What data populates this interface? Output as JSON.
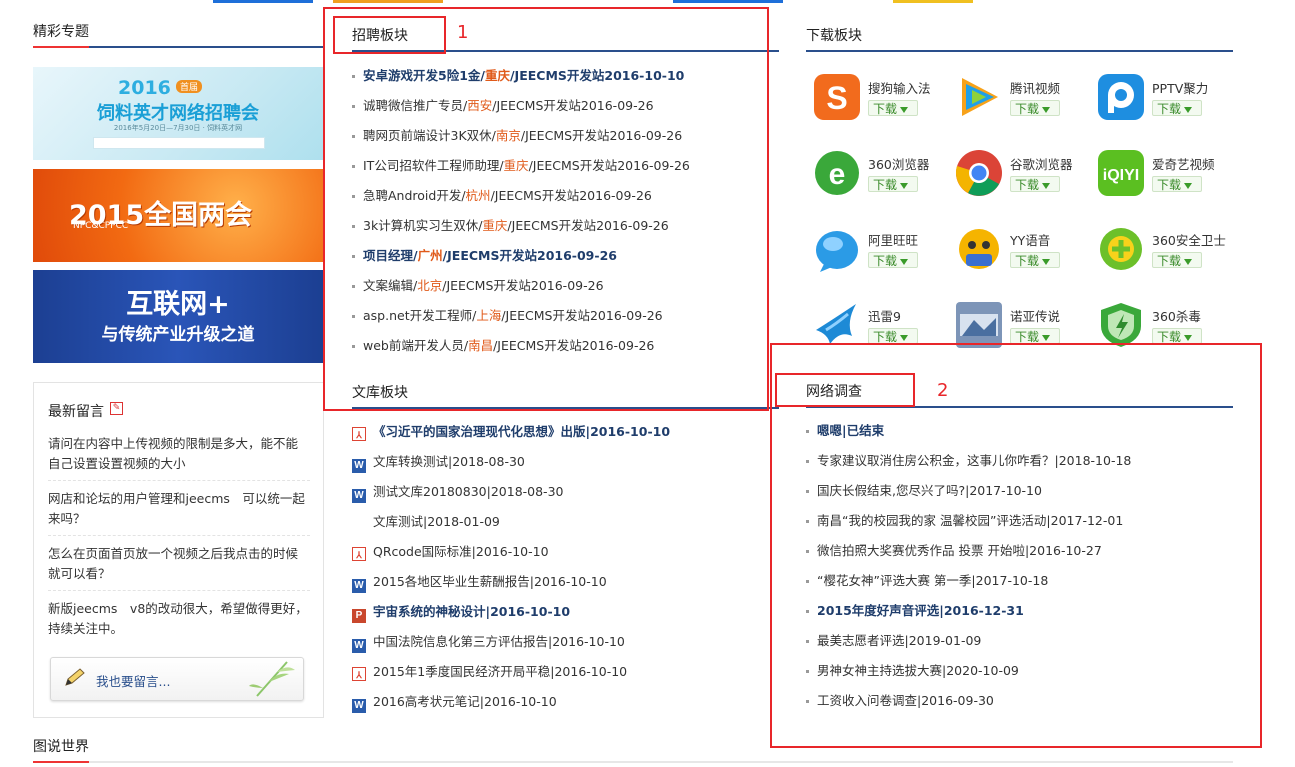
{
  "annotations": {
    "box1_number": "1",
    "box2_number": "2"
  },
  "featured": {
    "title": "精彩专题",
    "banners": [
      {
        "title": "饲料英才网络招聘会",
        "year": "2016",
        "tag": "首届",
        "sub": "2016年5月20日—7月30日 · 饲料英才网"
      },
      {
        "title": "2015全国两会",
        "sub": "NPC&CPPCC"
      },
      {
        "title": "互联网+",
        "sub": "与传统产业升级之道"
      }
    ]
  },
  "messages": {
    "title": "最新留言",
    "items": [
      "请问在内容中上传视频的限制是多大，能不能自己设置设置视频的大小",
      "网店和论坛的用户管理和jeecms　可以统一起来吗？",
      "怎么在页面首页放一个视频之后我点击的时候就可以看？",
      "新版jeecms　v8的改动很大，希望做得更好，持续关注中。"
    ],
    "leave_button": "我也要留言..."
  },
  "recruit": {
    "title": "招聘板块",
    "items": [
      {
        "job": "安卓游戏开发5险1金/",
        "city": "重庆",
        "rest": "/JEECMS开发站2016-10-10",
        "bold": true
      },
      {
        "job": "诚聘微信推广专员/",
        "city": "西安",
        "rest": "/JEECMS开发站2016-09-26",
        "bold": false
      },
      {
        "job": "聘网页前端设计3K双休/",
        "city": "南京",
        "rest": "/JEECMS开发站2016-09-26",
        "bold": false
      },
      {
        "job": "IT公司招软件工程师助理/",
        "city": "重庆",
        "rest": "/JEECMS开发站2016-09-26",
        "bold": false
      },
      {
        "job": "急聘Android开发/",
        "city": "杭州",
        "rest": "/JEECMS开发站2016-09-26",
        "bold": false
      },
      {
        "job": "3k计算机实习生双休/",
        "city": "重庆",
        "rest": "/JEECMS开发站2016-09-26",
        "bold": false
      },
      {
        "job": "项目经理/",
        "city": "广州",
        "rest": "/JEECMS开发站2016-09-26",
        "bold": true
      },
      {
        "job": "文案编辑/",
        "city": "北京",
        "rest": "/JEECMS开发站2016-09-26",
        "bold": false
      },
      {
        "job": "asp.net开发工程师/",
        "city": "上海",
        "rest": "/JEECMS开发站2016-09-26",
        "bold": false
      },
      {
        "job": "web前端开发人员/",
        "city": "南昌",
        "rest": "/JEECMS开发站2016-09-26",
        "bold": false
      }
    ]
  },
  "library": {
    "title": "文库板块",
    "items": [
      {
        "icon": "pdf",
        "text": "《习近平的国家治理现代化思想》出版|2016-10-10",
        "bold": true
      },
      {
        "icon": "word",
        "text": "文库转换测试|2018-08-30",
        "bold": false
      },
      {
        "icon": "word",
        "text": "测试文库20180830|2018-08-30",
        "bold": false
      },
      {
        "icon": "none",
        "text": "文库测试|2018-01-09",
        "bold": false
      },
      {
        "icon": "pdf",
        "text": "QRcode国际标准|2016-10-10",
        "bold": false
      },
      {
        "icon": "word",
        "text": "2015各地区毕业生薪酬报告|2016-10-10",
        "bold": false
      },
      {
        "icon": "ppt",
        "text": "宇宙系统的神秘设计|2016-10-10",
        "bold": true
      },
      {
        "icon": "word",
        "text": "中国法院信息化第三方评估报告|2016-10-10",
        "bold": false
      },
      {
        "icon": "pdf",
        "text": "2015年1季度国民经济开局平稳|2016-10-10",
        "bold": false
      },
      {
        "icon": "word",
        "text": "2016高考状元笔记|2016-10-10",
        "bold": false
      }
    ]
  },
  "downloads": {
    "title": "下载板块",
    "button_label": "下载",
    "apps": [
      {
        "name": "搜狗输入法",
        "icon": "sogou-icon",
        "color": "#f26b1d"
      },
      {
        "name": "腾讯视频",
        "icon": "tencent-video-icon",
        "color": "#20a0e8"
      },
      {
        "name": "PPTV聚力",
        "icon": "pptv-icon",
        "color": "#1e8ee0"
      },
      {
        "name": "360浏览器",
        "icon": "360-browser-icon",
        "color": "#3aa83a"
      },
      {
        "name": "谷歌浏览器",
        "icon": "chrome-icon",
        "color": "#db4437"
      },
      {
        "name": "爱奇艺视频",
        "icon": "iqiyi-icon",
        "color": "#5bbf21"
      },
      {
        "name": "阿里旺旺",
        "icon": "aliwangwang-icon",
        "color": "#2b9be6"
      },
      {
        "name": "YY语音",
        "icon": "yy-icon",
        "color": "#f5b400"
      },
      {
        "name": "360安全卫士",
        "icon": "360-safe-icon",
        "color": "#6cc02a"
      },
      {
        "name": "迅雷9",
        "icon": "xunlei-icon",
        "color": "#1d8ad6"
      },
      {
        "name": "诺亚传说",
        "icon": "noah-icon",
        "color": "#4a6fa0"
      },
      {
        "name": "360杀毒",
        "icon": "360-antivirus-icon",
        "color": "#3aa83a"
      }
    ]
  },
  "survey": {
    "title": "网络调查",
    "items": [
      {
        "text": "嗯嗯|已结束",
        "bold": true
      },
      {
        "text": "专家建议取消住房公积金，这事儿你咋看？|2018-10-18",
        "bold": false
      },
      {
        "text": "国庆长假结束,您尽兴了吗?|2017-10-10",
        "bold": false
      },
      {
        "text": "南昌“我的校园我的家 温馨校园”评选活动|2017-12-01",
        "bold": false
      },
      {
        "text": "微信拍照大奖赛优秀作品 投票 开始啦|2016-10-27",
        "bold": false
      },
      {
        "text": "“樱花女神”评选大赛 第一季|2017-10-18",
        "bold": false
      },
      {
        "text": "2015年度好声音评选|2016-12-31",
        "bold": true
      },
      {
        "text": "最美志愿者评选|2019-01-09",
        "bold": false
      },
      {
        "text": "男神女神主持选拔大赛|2020-10-09",
        "bold": false
      },
      {
        "text": "工资收入问卷调查|2016-09-30",
        "bold": false
      }
    ]
  },
  "gallery": {
    "title": "图说世界"
  }
}
